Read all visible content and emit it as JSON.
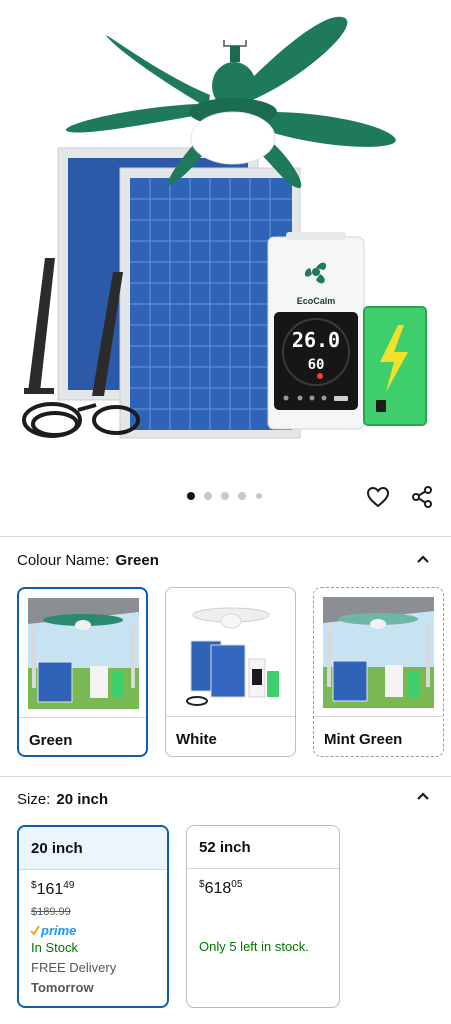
{
  "product": {
    "brand_label": "EcoCalm",
    "display_temp": "26.0",
    "display_sub": "60"
  },
  "carousel": {
    "image_count": 5,
    "active_index": 0
  },
  "colour": {
    "label": "Colour Name:",
    "selected": "Green",
    "options": [
      {
        "name": "Green"
      },
      {
        "name": "White"
      },
      {
        "name": "Mint Green"
      }
    ]
  },
  "size": {
    "label": "Size:",
    "selected": "20 inch",
    "options": [
      {
        "name": "20 inch",
        "price_currency": "$",
        "price_whole": "161",
        "price_fraction": "49",
        "list_price": "$189.99",
        "prime": "prime",
        "stock": "In Stock",
        "delivery": "FREE Delivery",
        "delivery_day": "Tomorrow"
      },
      {
        "name": "52 inch",
        "price_currency": "$",
        "price_whole": "618",
        "price_fraction": "05",
        "stock": "Only 5 left in stock."
      }
    ]
  },
  "colors": {
    "selected_border": "#0f5ea8",
    "in_stock_green": "#007600",
    "fan_green": "#1f7a5a",
    "prime_blue": "#1a98ff"
  }
}
